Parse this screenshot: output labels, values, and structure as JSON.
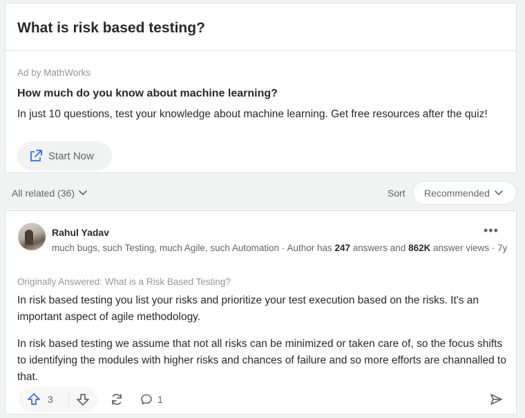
{
  "question": {
    "title": "What is risk based testing?"
  },
  "ad": {
    "sponsor": "Ad by MathWorks",
    "title": "How much do you know about machine learning?",
    "body": "In just 10 questions, test your knowledge about machine learning. Get free resources after the quiz!",
    "cta_label": "Start Now",
    "cta_icon": "external-link-icon"
  },
  "related": {
    "label": "All related (36)",
    "sort_label": "Sort",
    "sort_value": "Recommended"
  },
  "answer": {
    "author": "Rahul Yadav",
    "credential_prefix": "much bugs, such Testing, much Agile, such Automation · Author has ",
    "answers_count": "247",
    "answers_mid": " answers and ",
    "views_count": "862K",
    "views_suffix": " answer views · ",
    "age": "7y",
    "originally_answered": "Originally Answered: What is a Risk Based Testing?",
    "paragraph1": "In risk based testing you list your risks and prioritize your test execution based on the risks. It's an important aspect of agile methodology.",
    "paragraph2": "In risk based testing we assume that not all risks can be minimized or taken care of, so the focus shifts to identifying the modules with higher risks and chances of failure and so more efforts are channalled to that.",
    "upvotes": "3",
    "comments": "1",
    "more_label": "•••"
  },
  "colors": {
    "accent_blue": "#2e69ff",
    "text_primary": "#282829",
    "text_secondary": "#636466",
    "text_muted": "#939598",
    "background": "#f1f2f2"
  }
}
